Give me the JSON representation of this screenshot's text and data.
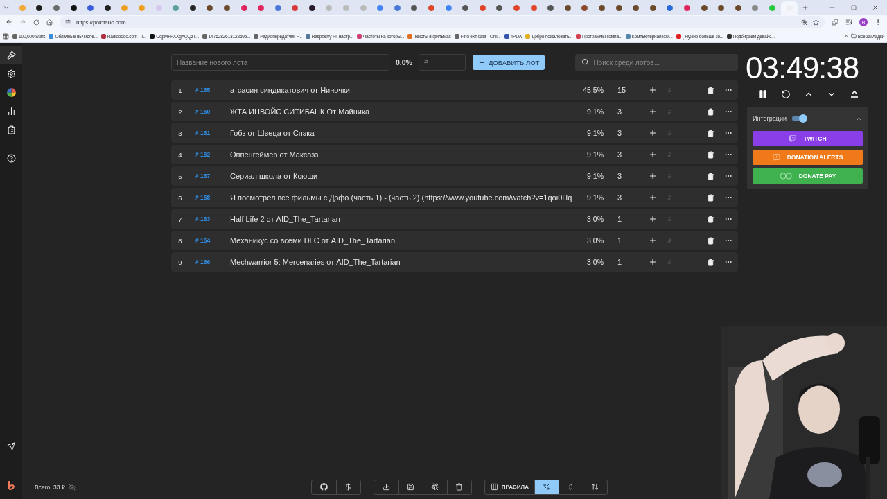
{
  "browser": {
    "tabs": [
      {
        "color": "#f2a93b",
        "selected": false
      },
      {
        "color": "#1d1d1d",
        "selected": false
      },
      {
        "color": "#6b6b6b",
        "selected": false
      },
      {
        "color": "#111111",
        "selected": false
      },
      {
        "color": "#3b5bdb",
        "selected": false
      },
      {
        "color": "#222222",
        "selected": false
      },
      {
        "color": "#f0a020",
        "selected": false
      },
      {
        "color": "#f0a020",
        "selected": false
      },
      {
        "color": "#d6c8f0",
        "selected": false
      },
      {
        "color": "#5aa0a0",
        "selected": false
      },
      {
        "color": "#222222",
        "selected": false
      },
      {
        "color": "#6b4a2b",
        "selected": false
      },
      {
        "color": "#6b4a2b",
        "selected": false
      },
      {
        "color": "#e0245e",
        "selected": false
      },
      {
        "color": "#e0245e",
        "selected": false
      },
      {
        "color": "#4a78d8",
        "selected": false
      },
      {
        "color": "#d83a3a",
        "selected": false
      },
      {
        "color": "#2a1a2a",
        "selected": false
      },
      {
        "color": "#bbbbbb",
        "selected": false
      },
      {
        "color": "#bbbbbb",
        "selected": false
      },
      {
        "color": "#bbbbbb",
        "selected": false
      },
      {
        "color": "#4285f4",
        "selected": false
      },
      {
        "color": "#4a78d8",
        "selected": false
      },
      {
        "color": "#555555",
        "selected": false
      },
      {
        "color": "#e0452a",
        "selected": false
      },
      {
        "color": "#4285f4",
        "selected": false
      },
      {
        "color": "#555555",
        "selected": false
      },
      {
        "color": "#e0452a",
        "selected": false
      },
      {
        "color": "#555555",
        "selected": false
      },
      {
        "color": "#e0452a",
        "selected": false
      },
      {
        "color": "#e0452a",
        "selected": false
      },
      {
        "color": "#555555",
        "selected": false
      },
      {
        "color": "#6b4a2b",
        "selected": false
      },
      {
        "color": "#8b4a2b",
        "selected": false
      },
      {
        "color": "#6b4a2b",
        "selected": false
      },
      {
        "color": "#6b4a2b",
        "selected": false
      },
      {
        "color": "#6b4a2b",
        "selected": false
      },
      {
        "color": "#6b4a2b",
        "selected": false
      },
      {
        "color": "#2a6ad8",
        "selected": false
      },
      {
        "color": "#e0245e",
        "selected": false
      },
      {
        "color": "#6b4a2b",
        "selected": false
      },
      {
        "color": "#6b4a2b",
        "selected": false
      },
      {
        "color": "#6b4a2b",
        "selected": false
      },
      {
        "color": "#888888",
        "selected": false
      },
      {
        "color": "#27c93f",
        "selected": false
      },
      {
        "color": "#eeeeee",
        "selected": true
      }
    ],
    "url": "https://pointauc.com",
    "profile_initial": "B",
    "bookmarks": [
      {
        "label": "100,000 Stars",
        "color": "#666666"
      },
      {
        "label": "Облачные вычисле...",
        "color": "#3b8dd8"
      },
      {
        "label": "Radiooooo.com - T...",
        "color": "#b03040"
      },
      {
        "label": "CqpMFFXXgAQQzT...",
        "color": "#111111"
      },
      {
        "label": "1476282613122595...",
        "color": "#666666"
      },
      {
        "label": "Радиопередатчик F...",
        "color": "#666666"
      },
      {
        "label": "Raspberry Pi: настр...",
        "color": "#557799"
      },
      {
        "label": "Частоты на которы...",
        "color": "#d04070"
      },
      {
        "label": "Тексты в фильмах",
        "color": "#e07020"
      },
      {
        "label": "Find exif data - Onli...",
        "color": "#666666"
      },
      {
        "label": "4PDA",
        "color": "#3355aa"
      },
      {
        "label": "Добро пожаловать...",
        "color": "#e0b020"
      },
      {
        "label": "Программы компа...",
        "color": "#d04050"
      },
      {
        "label": "Компьютерная кри...",
        "color": "#5588aa"
      },
      {
        "label": "( Нужно больше зо...",
        "color": "#e02020"
      },
      {
        "label": "Подбираем девайс...",
        "color": "#333333"
      }
    ],
    "more": "»",
    "all_bookmarks": "Все закладки"
  },
  "sidebar": {
    "items": [
      {
        "kind": "gavel",
        "selected": true
      },
      {
        "kind": "settings",
        "selected": false
      },
      {
        "kind": "pie",
        "selected": false
      },
      {
        "kind": "stats",
        "selected": false
      },
      {
        "kind": "history",
        "selected": false
      },
      {
        "kind": "help",
        "selected": false
      }
    ]
  },
  "new_lot": {
    "placeholder": "Название нового лота",
    "percent": "0.0%",
    "amount_placeholder": "₽",
    "add_button": "ДОБАВИТЬ ЛОТ"
  },
  "search": {
    "placeholder": "Поиск среди лотов..."
  },
  "lots": [
    {
      "index": "1",
      "id": "# 165",
      "name": "атсасин синдикатович от Ниночки",
      "percent": "45.5%",
      "amount": "15",
      "currency": "₽"
    },
    {
      "index": "2",
      "id": "# 160",
      "name": "ЖТА ИНВОЙС СИТИБАНК От Майника",
      "percent": "9.1%",
      "amount": "3",
      "currency": "₽"
    },
    {
      "index": "3",
      "id": "# 161",
      "name": "Гобз от Швеца от Спэка",
      "percent": "9.1%",
      "amount": "3",
      "currency": "₽"
    },
    {
      "index": "4",
      "id": "# 162",
      "name": "Оппенгеймер от Максазз",
      "percent": "9.1%",
      "amount": "3",
      "currency": "₽"
    },
    {
      "index": "5",
      "id": "# 167",
      "name": "Сериал школа от Ксюши",
      "percent": "9.1%",
      "amount": "3",
      "currency": "₽"
    },
    {
      "index": "6",
      "id": "# 168",
      "name": "Я посмотрел все фильмы с Дэфо (часть 1) - (часть 2) (https://www.youtube.com/watch?v=1qoi0Hq",
      "percent": "9.1%",
      "amount": "3",
      "currency": "₽"
    },
    {
      "index": "7",
      "id": "# 163",
      "name": "Half Life 2 от AID_The_Tartarian",
      "percent": "3.0%",
      "amount": "1",
      "currency": "₽"
    },
    {
      "index": "8",
      "id": "# 164",
      "name": "Механикус со всеми DLC от AID_The_Tartarian",
      "percent": "3.0%",
      "amount": "1",
      "currency": "₽"
    },
    {
      "index": "9",
      "id": "# 166",
      "name": "Mechwarrior 5: Mercenaries от AID_The_Tartarian",
      "percent": "3.0%",
      "amount": "1",
      "currency": "₽"
    }
  ],
  "timer": {
    "time": "03:49:38"
  },
  "integrations": {
    "label": "Интеграции",
    "on": true,
    "expanded": true,
    "buttons": [
      {
        "kind": "twitch",
        "label": "TWITCH",
        "color": "#8a3ee8"
      },
      {
        "kind": "alerts",
        "label": "DONATION ALERTS",
        "color": "#f07a1a"
      },
      {
        "kind": "donatepay",
        "label": "DONATE PAY",
        "color": "#3fb24f"
      }
    ]
  },
  "footer": {
    "total": "Всего: 33 ₽",
    "groups": [
      {
        "buttons": [
          {
            "kind": "github"
          },
          {
            "kind": "dollar"
          }
        ]
      },
      {
        "buttons": [
          {
            "kind": "download"
          },
          {
            "kind": "save"
          },
          {
            "kind": "bug"
          },
          {
            "kind": "clear"
          }
        ]
      },
      {
        "buttons": [
          {
            "kind": "rules",
            "label": "ПРАВИЛА",
            "selected": false
          },
          {
            "kind": "percent",
            "selected": true
          },
          {
            "kind": "split",
            "selected": false
          },
          {
            "kind": "sort",
            "selected": false
          }
        ]
      }
    ]
  }
}
